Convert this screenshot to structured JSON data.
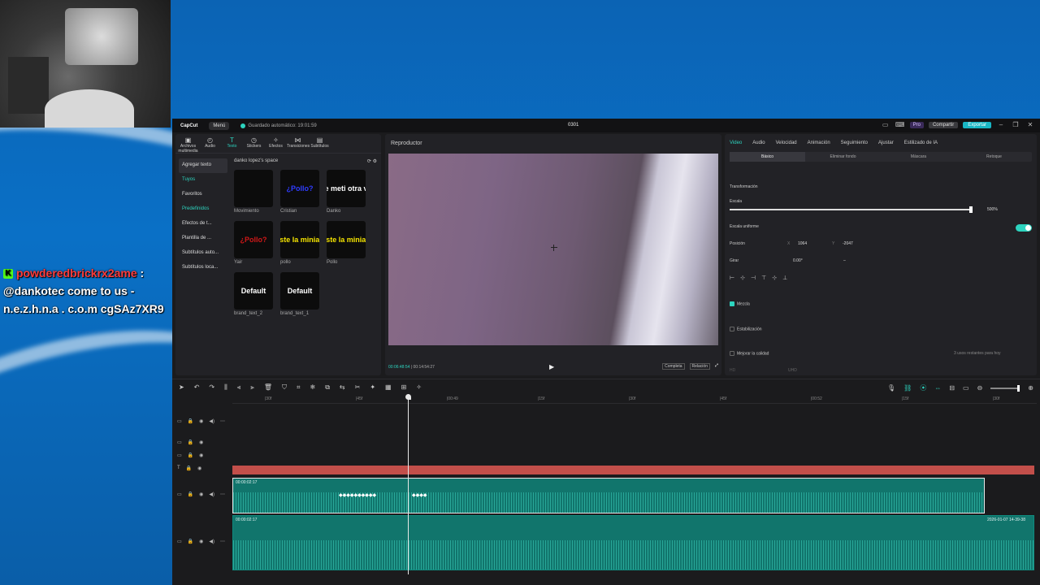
{
  "overlay": {
    "chat": {
      "badge": "K",
      "username": "powderedbrickrx2ame",
      "separator": ":",
      "line1": "@dankotec come to us -",
      "line2": "n.e.z.h.n.a . c.o.m cgSAz7XR9"
    }
  },
  "app": {
    "title": {
      "logo": "CapCut",
      "menu": "Menú",
      "autosave": "Guardado automático: 19:01:59",
      "project": "0301",
      "pro": "Pro",
      "share": "Compartir",
      "export": "Exportar"
    },
    "media_tabs": [
      {
        "icon": "▣",
        "label": "Archivos multimedia"
      },
      {
        "icon": "◴",
        "label": "Audio"
      },
      {
        "icon": "T",
        "label": "Texto"
      },
      {
        "icon": "◷",
        "label": "Stickers"
      },
      {
        "icon": "✧",
        "label": "Efectos"
      },
      {
        "icon": "⋈",
        "label": "Transiciones"
      },
      {
        "icon": "▤",
        "label": "Subtítulos"
      }
    ],
    "left_nav": [
      "Agregar texto",
      "Tuyos",
      "Favoritos",
      "Predefinidos",
      "Efectos de t...",
      "Plantilla de ...",
      "Subtítulos auto...",
      "Subtítulos loca..."
    ],
    "space_name": "danko lopez's space",
    "tiles": [
      {
        "text": "",
        "label": "Movimiento",
        "color": "#ffffff"
      },
      {
        "text": "¿Pollo?",
        "label": "Cristian",
        "color": "#2f3cff"
      },
      {
        "text": "e meti otra v",
        "label": "Danko",
        "color": "#ffffff"
      },
      {
        "text": "¿Pollo?",
        "label": "Yair",
        "color": "#d01818"
      },
      {
        "text": "iste la miniat",
        "label": "pollo",
        "color": "#f5e400"
      },
      {
        "text": "iste la miniat",
        "label": "Pollo",
        "color": "#f5e400"
      },
      {
        "text": "Default",
        "label": "brand_text_2",
        "color": "#ffffff"
      },
      {
        "text": "Default",
        "label": "brand_text_1",
        "color": "#ffffff"
      }
    ],
    "player": {
      "title": "Reproductor",
      "current_time": "00:06:48:54",
      "total_time": "00:14:54:27",
      "full": "Completa",
      "ratio": "Relación"
    },
    "props": {
      "tabs": [
        "Video",
        "Audio",
        "Velocidad",
        "Animación",
        "Seguimiento",
        "Ajustar",
        "Estilizado de IA"
      ],
      "subtabs": [
        "Básico",
        "Eliminar fondo",
        "Máscara",
        "Retoque"
      ],
      "transform": "Transformación",
      "scale_label": "Escala",
      "scale_value": "500%",
      "scale_fraction": 1.0,
      "uniform_scale": "Escala uniforme",
      "position_label": "Posición",
      "pos_x_label": "X",
      "pos_x": "1064",
      "pos_y_label": "Y",
      "pos_y": "-2047",
      "rotate_label": "Girar",
      "rotate_value": "0.00°",
      "rotate_dash": "–",
      "blend": "Mezcla",
      "stabilize": "Estabilización",
      "enhance": "Mejorar la calidad",
      "uses_left": "3 usos restantes para hoy",
      "hd_label": "HD",
      "uhd_label": "UHD"
    },
    "timeline": {
      "ruler": [
        "|30f",
        "|45f",
        "|00:49",
        "|15f",
        "|30f",
        "|45f",
        "|00:52",
        "|15f",
        "|30f"
      ],
      "clip1_time": "00:00:02:17",
      "clip2_time": "00:00:02:17",
      "clip2_date": "2026-01-07 14-39-38",
      "diamonds_a": "◆◆◆◆◆◆◆◆◆◆",
      "diamonds_b": "◆◆◆◆"
    },
    "colors": {
      "accent": "#2dd4bf",
      "export": "#19b6c4",
      "red_track": "#c24f4a",
      "clip": "#11756c"
    }
  }
}
